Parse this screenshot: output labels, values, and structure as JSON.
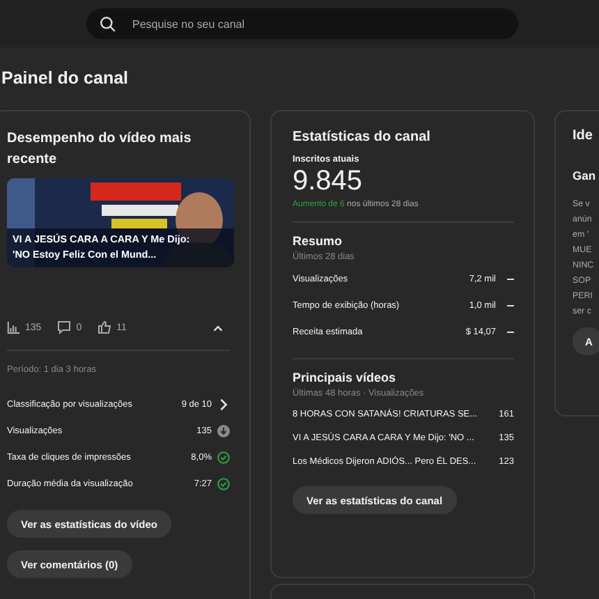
{
  "search": {
    "placeholder": "Pesquise no seu canal"
  },
  "page_title": "Painel do canal",
  "latest_video": {
    "title": "Desempenho do vídeo mais recente",
    "thumbnail": {
      "kind": "picture"
    },
    "video_title": "VI A JESÚS CARA A CARA Y Me Dijo: 'NO Estoy Feliz Con el Mund...",
    "views": "135",
    "comments": "0",
    "likes": "11",
    "expanded": true,
    "period": "Período: 1 dia 3 horas",
    "metrics": [
      {
        "label": "Classificação por visualizações",
        "value": "9 de 10",
        "kind": "link"
      },
      {
        "label": "Visualizações",
        "value": "135",
        "kind": "down"
      },
      {
        "label": "Taxa de cliques de impressões",
        "value": "8,0%",
        "kind": "check"
      },
      {
        "label": "Duração média da visualização",
        "value": "7:27",
        "kind": "check"
      }
    ],
    "buttons": [
      "Ver as estatísticas do vídeo",
      "Ver comentários (0)"
    ]
  },
  "channel_stats": {
    "title": "Estatísticas do canal",
    "subscribers_label": "Inscritos atuais",
    "subscribers": "9.845",
    "growth_highlight": "Aumento de 6",
    "growth_rest": "nos últimos 28 dias",
    "summary_title": "Resumo",
    "summary_period": "Últimos 28 dias",
    "summary": [
      {
        "label": "Visualizações",
        "value": "7,2 mil"
      },
      {
        "label": "Tempo de exibição (horas)",
        "value": "1,0 mil"
      },
      {
        "label": "Receita estimada",
        "value": "$ 14,07"
      }
    ],
    "top_title": "Principais vídeos",
    "top_period": "Últimas 48 horas · Visualizações",
    "top_videos": [
      {
        "title": "8 HORAS CON SATANÁS! CRIATURAS SE...",
        "views": "161"
      },
      {
        "title": "VI A JESÚS CARA A CARA Y Me Dijo: 'NO ...",
        "views": "135"
      },
      {
        "title": "Los Médicos Dijeron ADIÓS... Pero ÉL DES...",
        "views": "123"
      }
    ],
    "button": "Ver as estatísticas do canal"
  },
  "ideas": {
    "title": "Ide",
    "subtitle": "Gan",
    "lines": [
      "Se v",
      "anún",
      "em '",
      "MUE",
      "NINC",
      "SOP",
      "PERI",
      "ser c"
    ],
    "button": "A"
  }
}
